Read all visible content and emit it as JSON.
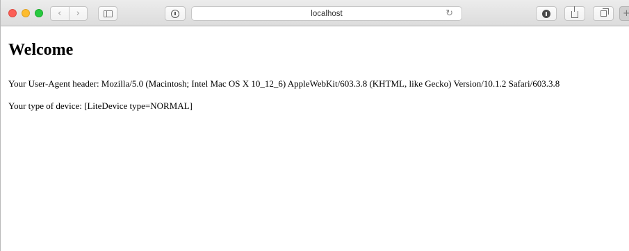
{
  "browser": {
    "address": "localhost",
    "nav": {
      "back_glyph": "‹",
      "forward_glyph": "›"
    },
    "reload_glyph": "↻",
    "newtab_glyph": "+",
    "icons": {
      "reader": "reader-icon",
      "sidebar": "sidebar-icon",
      "download": "download-icon",
      "share": "share-icon",
      "tabs": "tabs-icon"
    },
    "traffic_lights": {
      "close": "#fc5f57",
      "minimize": "#fdbc2e",
      "zoom": "#27c93f"
    }
  },
  "page": {
    "heading": "Welcome",
    "user_agent_line": "Your User-Agent header: Mozilla/5.0 (Macintosh; Intel Mac OS X 10_12_6) AppleWebKit/603.3.8 (KHTML, like Gecko) Version/10.1.2 Safari/603.3.8",
    "device_line": "Your type of device: [LiteDevice type=NORMAL]"
  }
}
